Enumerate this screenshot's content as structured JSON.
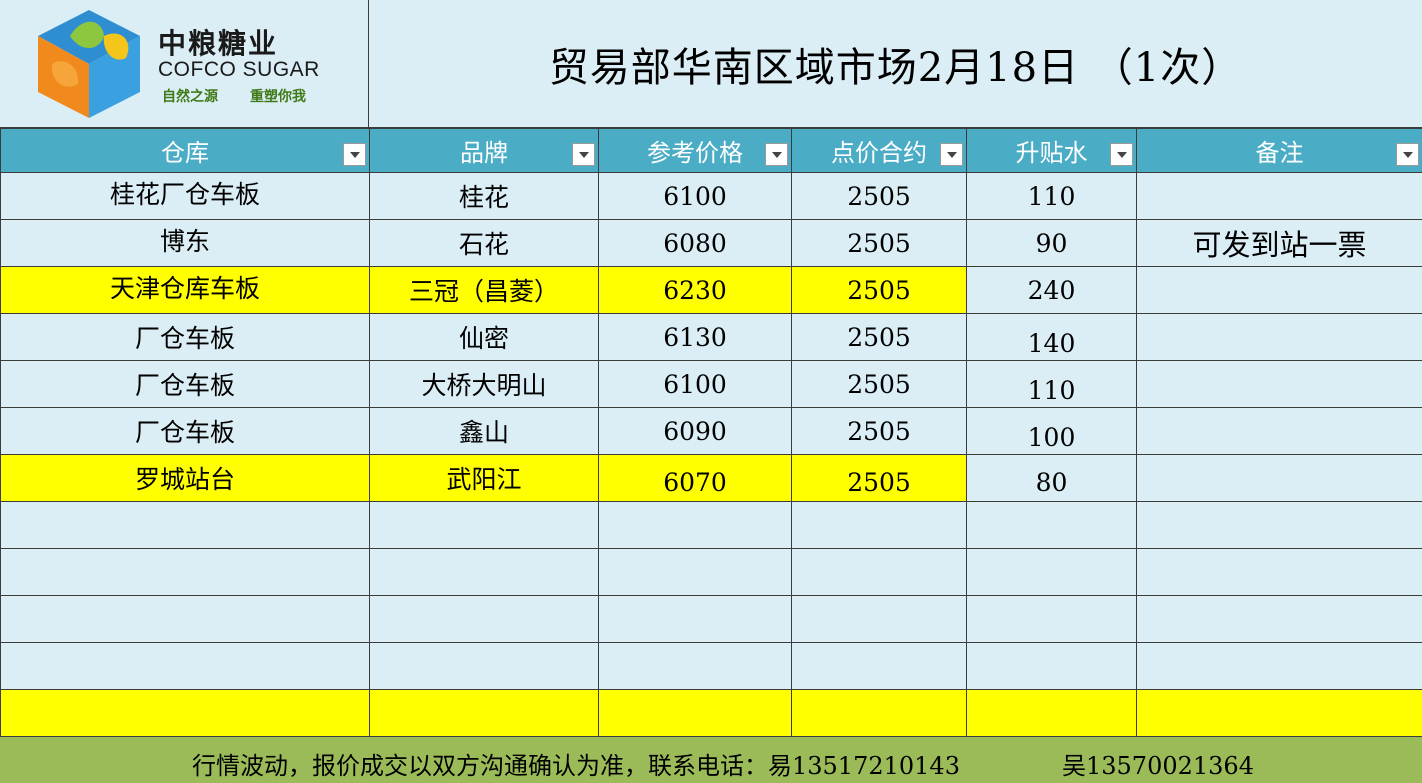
{
  "logo": {
    "cn_name": "中粮糖业",
    "en_name": "COFCO SUGAR",
    "slogan_left": "自然之源",
    "slogan_right": "重塑你我",
    "colors": {
      "orange": "#f08a1c",
      "blue": "#2f8ed1",
      "green": "#8dc63f",
      "yellow": "#f4c51a"
    }
  },
  "title": "贸易部华南区域市场2月18日 （1次）",
  "columns": [
    "仓库",
    "品牌",
    "参考价格",
    "点价合约",
    "升贴水",
    "备注"
  ],
  "rows": [
    {
      "warehouse": "桂花厂仓车板",
      "brand": "桂花",
      "price": "6100",
      "contract": "2505",
      "premium": "110",
      "note": ""
    },
    {
      "warehouse": "博东",
      "brand": "石花",
      "price": "6080",
      "contract": "2505",
      "premium": "90",
      "note": "可发到站一票"
    },
    {
      "warehouse": "天津仓库车板",
      "brand": "三冠（昌菱）",
      "price": "6230",
      "contract": "2505",
      "premium": "240",
      "note": ""
    },
    {
      "warehouse": "厂仓车板",
      "brand": "仙密",
      "price": "6130",
      "contract": "2505",
      "premium": "140",
      "note": ""
    },
    {
      "warehouse": "厂仓车板",
      "brand": "大桥大明山",
      "price": "6100",
      "contract": "2505",
      "premium": "110",
      "note": ""
    },
    {
      "warehouse": "厂仓车板",
      "brand": "鑫山",
      "price": "6090",
      "contract": "2505",
      "premium": "100",
      "note": ""
    },
    {
      "warehouse": "罗城站台",
      "brand": "武阳江",
      "price": "6070",
      "contract": "2505",
      "premium": "80",
      "note": ""
    }
  ],
  "footer": {
    "text": "行情波动，报价成交以双方沟通确认为准，联系电话：易13517210143",
    "text2": "吴13570021364"
  },
  "colors": {
    "header_bg": "#4bacc6",
    "cell_bg": "#dbeef5",
    "highlight": "#ffff00",
    "red_text": "#ff0000",
    "footer_bg": "#9bbb59"
  }
}
